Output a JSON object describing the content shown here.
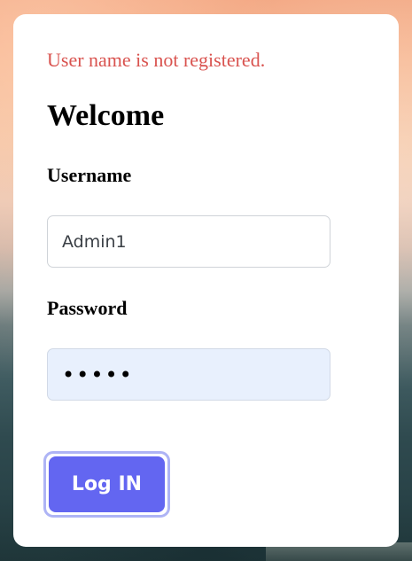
{
  "form": {
    "error_message": "User name is not registered.",
    "title": "Welcome",
    "username_label": "Username",
    "username_value": "Admin1",
    "password_label": "Password",
    "password_value": "•••••",
    "login_button_label": "Log IN"
  },
  "colors": {
    "error": "#d9534f",
    "accent": "#6366f1",
    "accent_ring": "#aeb4f5",
    "autofill_bg": "#e8f0fd"
  }
}
